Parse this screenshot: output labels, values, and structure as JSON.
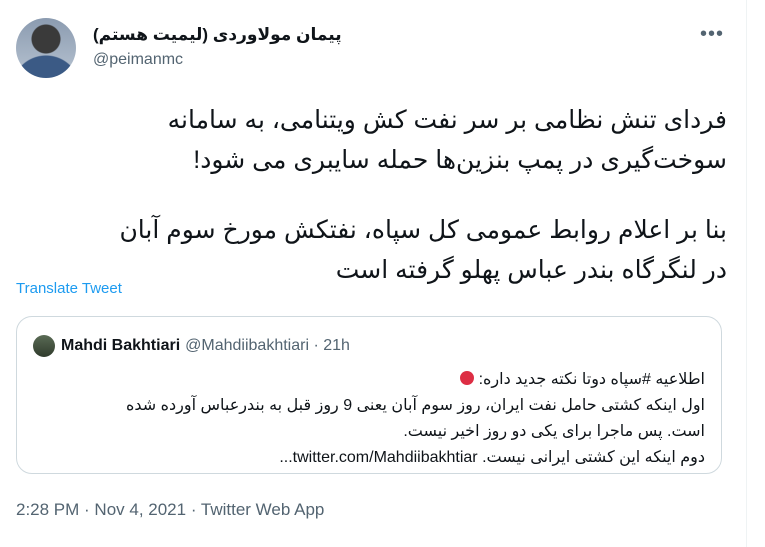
{
  "tweet": {
    "author_name": "پیمان مولاوردی (لیمیت هستم)",
    "author_handle": "@peimanmc",
    "more_icon": "more-icon",
    "body_lines": [
      "فردای تنش نظامی بر سر نفت کش ویتنامی، به سامانه",
      "سوخت‌گیری در پمپ بنزین‌ها حمله سایبری می شود!",
      "بنا بر اعلام روابط عمومی کل سپاه، نفتکش مورخ سوم آبان",
      "در  لنگرگاه بندر عباس پهلو گرفته است"
    ],
    "translate_label": "Translate Tweet",
    "footer": "2:28 PM · Nov 4, 2021 · Twitter Web App"
  },
  "quote": {
    "name": "Mahdi Bakhtiari",
    "handle_time": "@Mahdiibakhtiari · 21h",
    "lines": [
      "اطلاعیه #سپاه دوتا نکته جدید داره:",
      "اول اینکه کشتی حامل نفت ایران، روز سوم آبان یعنی 9 روز قبل به بندرعباس آورده شده",
      "است. پس ماجرا برای یکی دو روز اخیر نیست.",
      "دوم اینکه این کشتی ایرانی نیست. twitter.com/Mahdiibakhtiar..."
    ]
  }
}
